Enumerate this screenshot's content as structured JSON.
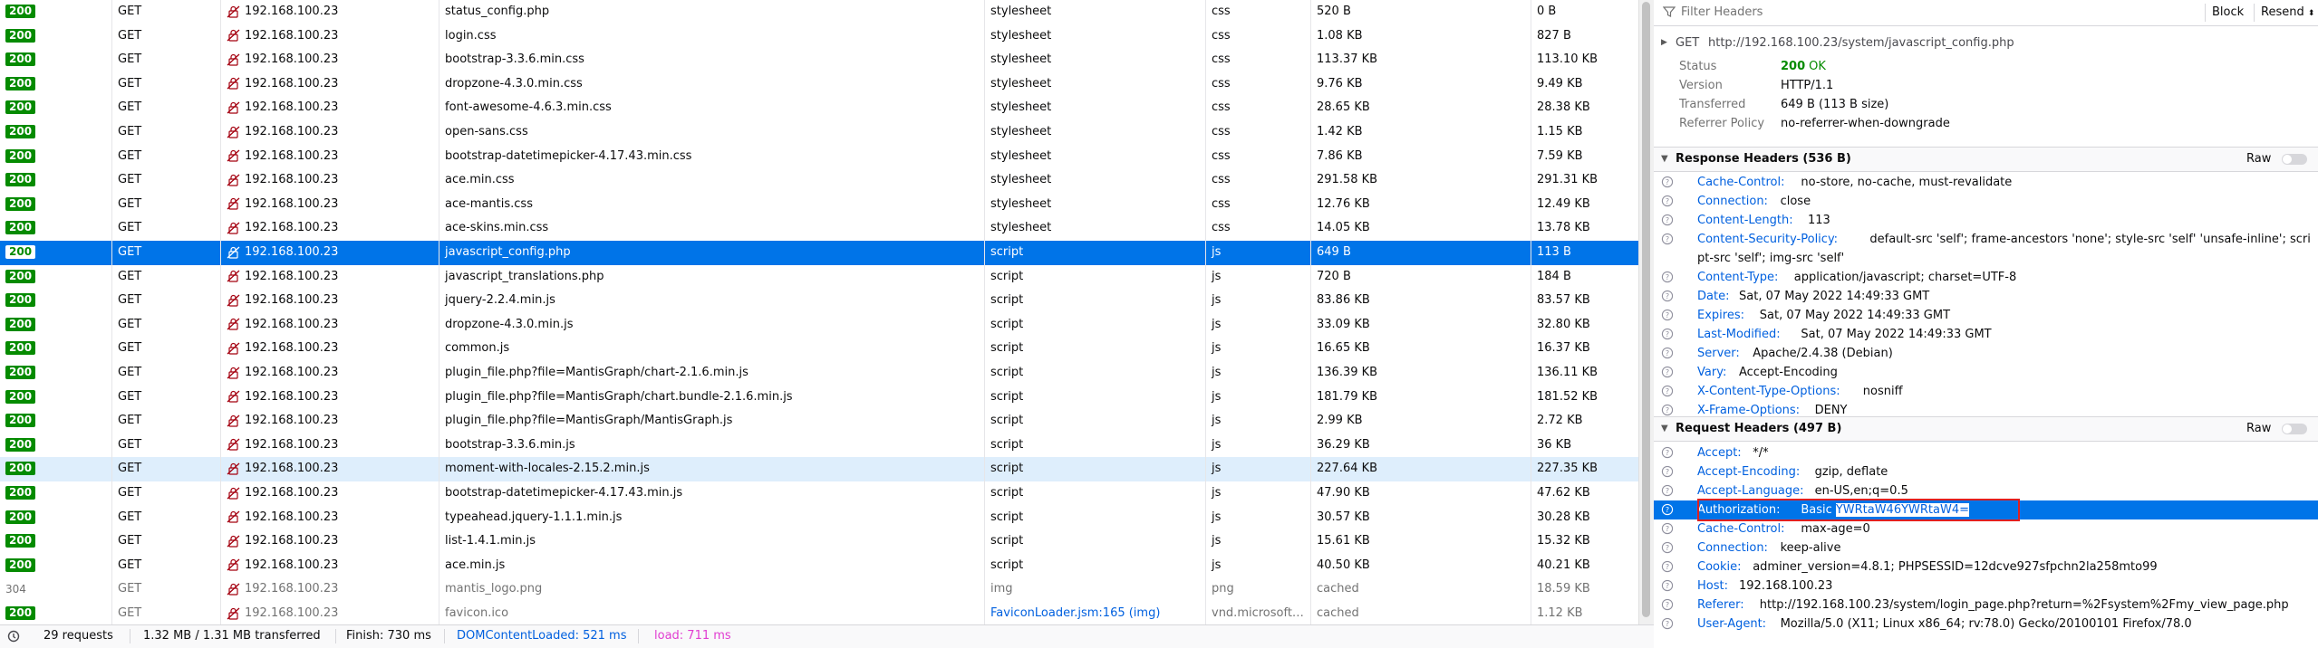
{
  "colors": {
    "selected_row": "#0074e8",
    "status_ok": "#058b00",
    "header_name": "#0060df",
    "dom_loaded": "#0060df",
    "load": "#e13dd1"
  },
  "requests": [
    {
      "status": "200",
      "method": "GET",
      "domain": "192.168.100.23",
      "file": "status_config.php",
      "initiator": "stylesheet",
      "type": "css",
      "transferred": "520 B",
      "size": "0 B"
    },
    {
      "status": "200",
      "method": "GET",
      "domain": "192.168.100.23",
      "file": "login.css",
      "initiator": "stylesheet",
      "type": "css",
      "transferred": "1.08 KB",
      "size": "827 B"
    },
    {
      "status": "200",
      "method": "GET",
      "domain": "192.168.100.23",
      "file": "bootstrap-3.3.6.min.css",
      "initiator": "stylesheet",
      "type": "css",
      "transferred": "113.37 KB",
      "size": "113.10 KB"
    },
    {
      "status": "200",
      "method": "GET",
      "domain": "192.168.100.23",
      "file": "dropzone-4.3.0.min.css",
      "initiator": "stylesheet",
      "type": "css",
      "transferred": "9.76 KB",
      "size": "9.49 KB"
    },
    {
      "status": "200",
      "method": "GET",
      "domain": "192.168.100.23",
      "file": "font-awesome-4.6.3.min.css",
      "initiator": "stylesheet",
      "type": "css",
      "transferred": "28.65 KB",
      "size": "28.38 KB"
    },
    {
      "status": "200",
      "method": "GET",
      "domain": "192.168.100.23",
      "file": "open-sans.css",
      "initiator": "stylesheet",
      "type": "css",
      "transferred": "1.42 KB",
      "size": "1.15 KB"
    },
    {
      "status": "200",
      "method": "GET",
      "domain": "192.168.100.23",
      "file": "bootstrap-datetimepicker-4.17.43.min.css",
      "initiator": "stylesheet",
      "type": "css",
      "transferred": "7.86 KB",
      "size": "7.59 KB"
    },
    {
      "status": "200",
      "method": "GET",
      "domain": "192.168.100.23",
      "file": "ace.min.css",
      "initiator": "stylesheet",
      "type": "css",
      "transferred": "291.58 KB",
      "size": "291.31 KB"
    },
    {
      "status": "200",
      "method": "GET",
      "domain": "192.168.100.23",
      "file": "ace-mantis.css",
      "initiator": "stylesheet",
      "type": "css",
      "transferred": "12.76 KB",
      "size": "12.49 KB"
    },
    {
      "status": "200",
      "method": "GET",
      "domain": "192.168.100.23",
      "file": "ace-skins.min.css",
      "initiator": "stylesheet",
      "type": "css",
      "transferred": "14.05 KB",
      "size": "13.78 KB"
    },
    {
      "status": "200",
      "method": "GET",
      "domain": "192.168.100.23",
      "file": "javascript_config.php",
      "initiator": "script",
      "type": "js",
      "transferred": "649 B",
      "size": "113 B",
      "selected": true
    },
    {
      "status": "200",
      "method": "GET",
      "domain": "192.168.100.23",
      "file": "javascript_translations.php",
      "initiator": "script",
      "type": "js",
      "transferred": "720 B",
      "size": "184 B"
    },
    {
      "status": "200",
      "method": "GET",
      "domain": "192.168.100.23",
      "file": "jquery-2.2.4.min.js",
      "initiator": "script",
      "type": "js",
      "transferred": "83.86 KB",
      "size": "83.57 KB"
    },
    {
      "status": "200",
      "method": "GET",
      "domain": "192.168.100.23",
      "file": "dropzone-4.3.0.min.js",
      "initiator": "script",
      "type": "js",
      "transferred": "33.09 KB",
      "size": "32.80 KB"
    },
    {
      "status": "200",
      "method": "GET",
      "domain": "192.168.100.23",
      "file": "common.js",
      "initiator": "script",
      "type": "js",
      "transferred": "16.65 KB",
      "size": "16.37 KB"
    },
    {
      "status": "200",
      "method": "GET",
      "domain": "192.168.100.23",
      "file": "plugin_file.php?file=MantisGraph/chart-2.1.6.min.js",
      "initiator": "script",
      "type": "js",
      "transferred": "136.39 KB",
      "size": "136.11 KB"
    },
    {
      "status": "200",
      "method": "GET",
      "domain": "192.168.100.23",
      "file": "plugin_file.php?file=MantisGraph/chart.bundle-2.1.6.min.js",
      "initiator": "script",
      "type": "js",
      "transferred": "181.79 KB",
      "size": "181.52 KB"
    },
    {
      "status": "200",
      "method": "GET",
      "domain": "192.168.100.23",
      "file": "plugin_file.php?file=MantisGraph/MantisGraph.js",
      "initiator": "script",
      "type": "js",
      "transferred": "2.99 KB",
      "size": "2.72 KB"
    },
    {
      "status": "200",
      "method": "GET",
      "domain": "192.168.100.23",
      "file": "bootstrap-3.3.6.min.js",
      "initiator": "script",
      "type": "js",
      "transferred": "36.29 KB",
      "size": "36 KB"
    },
    {
      "status": "200",
      "method": "GET",
      "domain": "192.168.100.23",
      "file": "moment-with-locales-2.15.2.min.js",
      "initiator": "script",
      "type": "js",
      "transferred": "227.64 KB",
      "size": "227.35 KB",
      "hover": true
    },
    {
      "status": "200",
      "method": "GET",
      "domain": "192.168.100.23",
      "file": "bootstrap-datetimepicker-4.17.43.min.js",
      "initiator": "script",
      "type": "js",
      "transferred": "47.90 KB",
      "size": "47.62 KB"
    },
    {
      "status": "200",
      "method": "GET",
      "domain": "192.168.100.23",
      "file": "typeahead.jquery-1.1.1.min.js",
      "initiator": "script",
      "type": "js",
      "transferred": "30.57 KB",
      "size": "30.28 KB"
    },
    {
      "status": "200",
      "method": "GET",
      "domain": "192.168.100.23",
      "file": "list-1.4.1.min.js",
      "initiator": "script",
      "type": "js",
      "transferred": "15.61 KB",
      "size": "15.32 KB"
    },
    {
      "status": "200",
      "method": "GET",
      "domain": "192.168.100.23",
      "file": "ace.min.js",
      "initiator": "script",
      "type": "js",
      "transferred": "40.50 KB",
      "size": "40.21 KB"
    },
    {
      "status": "304",
      "method": "GET",
      "domain": "192.168.100.23",
      "file": "mantis_logo.png",
      "initiator": "img",
      "type": "png",
      "transferred": "cached",
      "size": "18.59 KB",
      "muted": true
    },
    {
      "status": "200",
      "method": "GET",
      "domain": "192.168.100.23",
      "file": "favicon.ico",
      "initiator": "FaviconLoader.jsm:165 (img)",
      "type": "vnd.microsoft…",
      "transferred": "cached",
      "size": "1.12 KB",
      "muted": true,
      "initiator_link": true
    }
  ],
  "statusbar": {
    "requests": "29 requests",
    "transferred": "1.32 MB / 1.31 MB transferred",
    "finish": "Finish: 730 ms",
    "dom": "DOMContentLoaded: 521 ms",
    "load": "load: 711 ms"
  },
  "panel": {
    "filter_placeholder": "Filter Headers",
    "block_label": "Block",
    "resend_label": "Resend",
    "request_line_method": "GET",
    "request_line_url": "http://192.168.100.23/system/javascript_config.php",
    "summary": [
      {
        "key": "Status",
        "value": "200",
        "extra": "OK"
      },
      {
        "key": "Version",
        "value": "HTTP/1.1"
      },
      {
        "key": "Transferred",
        "value": "649 B (113 B size)"
      },
      {
        "key": "Referrer Policy",
        "value": "no-referrer-when-downgrade"
      }
    ],
    "response_title": "Response Headers (536 B)",
    "request_title": "Request Headers (497 B)",
    "raw_label": "Raw",
    "response_headers": [
      {
        "name": "Cache-Control:",
        "value": "no-store, no-cache, must-revalidate"
      },
      {
        "name": "Connection:",
        "value": "close"
      },
      {
        "name": "Content-Length:",
        "value": "113"
      },
      {
        "name": "Content-Security-Policy:",
        "value": "default-src 'self'; frame-ancestors 'none'; style-src 'self' 'unsafe-inline'; scri",
        "value2": "pt-src 'self'; img-src 'self'"
      },
      {
        "name": "Content-Type:",
        "value": "application/javascript; charset=UTF-8"
      },
      {
        "name": "Date:",
        "value": "Sat, 07 May 2022 14:49:33 GMT"
      },
      {
        "name": "Expires:",
        "value": "Sat, 07 May 2022 14:49:33 GMT"
      },
      {
        "name": "Last-Modified:",
        "value": "Sat, 07 May 2022 14:49:33 GMT"
      },
      {
        "name": "Server:",
        "value": "Apache/2.4.38 (Debian)"
      },
      {
        "name": "Vary:",
        "value": "Accept-Encoding"
      },
      {
        "name": "X-Content-Type-Options:",
        "value": "nosniff"
      },
      {
        "name": "X-Frame-Options:",
        "value": "DENY"
      }
    ],
    "request_headers": [
      {
        "name": "Accept:",
        "value": "*/*"
      },
      {
        "name": "Accept-Encoding:",
        "value": "gzip, deflate"
      },
      {
        "name": "Accept-Language:",
        "value": "en-US,en;q=0.5"
      },
      {
        "name": "Authorization:",
        "value": "Basic",
        "highlight": "YWRtaW46YWRtaW4=",
        "selected": true
      },
      {
        "name": "Cache-Control:",
        "value": "max-age=0"
      },
      {
        "name": "Connection:",
        "value": "keep-alive"
      },
      {
        "name": "Cookie:",
        "value": "adminer_version=4.8.1; PHPSESSID=12dcve927sfpchn2la258mto99"
      },
      {
        "name": "Host:",
        "value": "192.168.100.23"
      },
      {
        "name": "Referer:",
        "value": "http://192.168.100.23/system/login_page.php?return=%2Fsystem%2Fmy_view_page.php"
      },
      {
        "name": "User-Agent:",
        "value": "Mozilla/5.0 (X11; Linux x86_64; rv:78.0) Gecko/20100101 Firefox/78.0"
      }
    ]
  }
}
